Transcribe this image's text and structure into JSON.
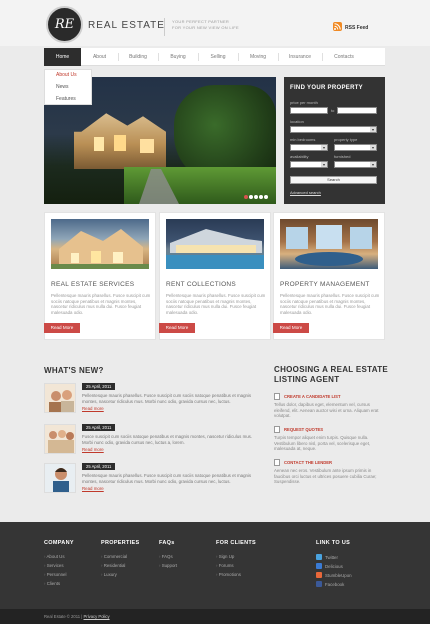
{
  "header": {
    "logo_text": "RE",
    "brand": "REAL ESTATE",
    "tagline_line1": "YOUR PERFECT PARTNER",
    "tagline_line2": "FOR YOUR NEW VIEW ON LIFE",
    "rss_label": "RSS Feed",
    "rss_color": "#f08a24"
  },
  "nav": {
    "items": [
      "Home",
      "About",
      "Building",
      "Buying",
      "Selling",
      "Moving",
      "Insurance",
      "Contacts"
    ],
    "active": "Home"
  },
  "submenu": [
    "About Us",
    "News",
    "Features"
  ],
  "find_property": {
    "title": "FIND YOUR PROPERTY",
    "price_label": "price per month",
    "to_label": "to",
    "location_label": "location",
    "bedrooms_label": "min bedrooms",
    "type_label": "property type",
    "availability_label": "availability",
    "furnished_label": "furnished",
    "search_button": "Search",
    "advanced_link": "Advanced search"
  },
  "services": [
    {
      "title": "REAL ESTATE SERVICES",
      "text": "Pellentesque mauris phasellus. Fusce suscipit cum sociis natoque penatibus et magnis montes, nascetur ridiculus mus nulla dui. Fusce feugiat malesuada odio.",
      "button": "Read More"
    },
    {
      "title": "RENT COLLECTIONS",
      "text": "Pellentesque mauris phasellus. Fusce suscipit cum sociis natoque penatibus et magnis montes, nascetur ridiculus mus nulla dui. Fusce feugiat malesuada odio.",
      "button": "Read More"
    },
    {
      "title": "PROPERTY MANAGEMENT",
      "text": "Pellentesque mauris phasellus. Fusce suscipit cum sociis natoque penatibus et magnis montes, nascetur ridiculus mus nulla dui. Fusce feugiat malesuada odio.",
      "button": "Read More"
    }
  ],
  "whats_new": {
    "title": "WHAT'S NEW?",
    "items": [
      {
        "date": "25 April, 2011",
        "text": "Pellentesque mauris phasellus. Fusce suscipit cum sociis natoque penatibus et magnis montes, nascetur ridiculus mus. Morbi nunc odio, gravida cursus nec, luctus.",
        "more": "Read more"
      },
      {
        "date": "25 April, 2011",
        "text": "Fusce suscipit cum sociis natoque penatibus et magnis montes, nascetur ridiculus mus. Morbi nunc odio, gravida cursus nec, luctus a, lorem.",
        "more": "Read more"
      },
      {
        "date": "25 April, 2011",
        "text": "Pellentesque mauris phasellus. Fusce suscipit cum sociis natoque penatibus et magnis montes, nascetur ridiculus mus. Morbi nunc odio, gravida cursus nec, luctus.",
        "more": "Read more"
      }
    ]
  },
  "agent": {
    "title_line1": "CHOOSING A REAL ESTATE",
    "title_line2": "LISTING AGENT",
    "items": [
      {
        "title": "CREATE A CANDIDATE LIST",
        "text": "Tellus dolor, dapibus eget, elementum vel, cursus eleifend, elit. Aenean auctor wisi et urna. Aliquam erat volutpat."
      },
      {
        "title": "REQUEST QUOTES",
        "text": "Turpis tempor aliquet enim turpis. Quisque nulla. Vestibulum libero nisl, porta vel, scelerisque eget, malesuada at, neque."
      },
      {
        "title": "CONTACT THE LENDER",
        "text": "Aenean nec eros. Vestibulum ante ipsum primis in faucibus orci luctus et ultrices posuere cubilia Curae; Suspendisse."
      }
    ]
  },
  "footer": {
    "columns": [
      {
        "title": "COMPANY",
        "links": [
          "About Us",
          "Services",
          "Personnel",
          "Clients"
        ]
      },
      {
        "title": "PROPERTIES",
        "links": [
          "Commercial",
          "Residential",
          "Luxury"
        ]
      },
      {
        "title": "FAQs",
        "links": [
          "FAQs",
          "Support"
        ]
      },
      {
        "title": "FOR CLIENTS",
        "links": [
          "Sign Up",
          "Forums",
          "Promotions"
        ]
      }
    ],
    "social_title": "LINK TO US",
    "social": [
      "Twitter",
      "Delicious",
      "StumbleUpon",
      "Facebook"
    ],
    "copyright": "Real Estate © 2011",
    "privacy": "Privacy Policy"
  },
  "accent_color": "#cc4a46"
}
